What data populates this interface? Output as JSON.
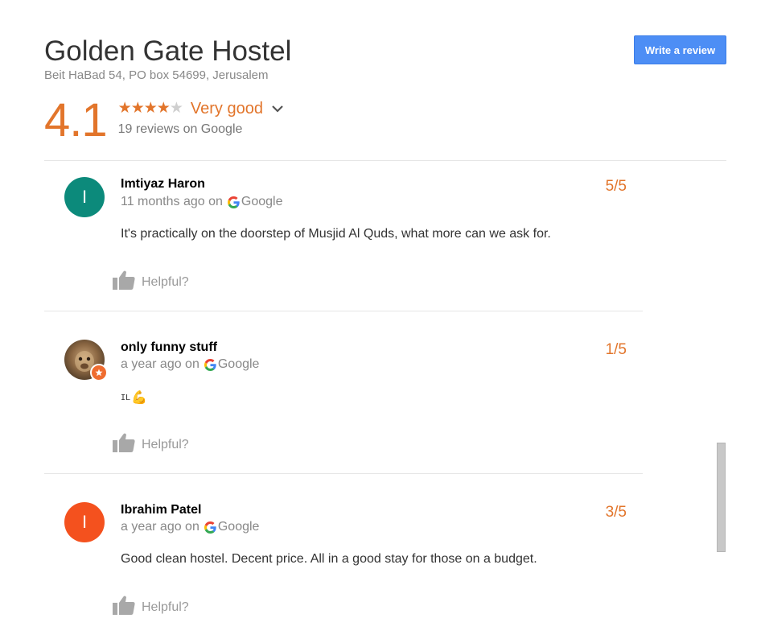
{
  "place": {
    "name": "Golden Gate Hostel",
    "address": "Beit HaBad 54, PO box 54699, Jerusalem"
  },
  "write_review_label": "Write a review",
  "summary": {
    "rating": "4.1",
    "stars_filled": 4,
    "stars_total": 5,
    "rating_word": "Very good",
    "review_count_text": "19 reviews on Google"
  },
  "colors": {
    "accent_orange": "#e2752b",
    "button_blue": "#4d8ef5",
    "avatar_teal": "#0c8a7b",
    "avatar_orange": "#f4511e"
  },
  "reviews": [
    {
      "author": "Imtiyaz Haron",
      "avatar_initial": "I",
      "avatar_type": "initial",
      "time": "11 months ago on",
      "source": "Google",
      "score": "5/5",
      "text": "It's practically on the doorstep of Musjid Al Quds, what more can we ask for.",
      "helpful_label": "Helpful?"
    },
    {
      "author": "only funny stuff",
      "avatar_type": "photo",
      "time": "a year ago on",
      "source": "Google",
      "score": "1/5",
      "text": "IL",
      "emoji": "💪",
      "helpful_label": "Helpful?"
    },
    {
      "author": "Ibrahim Patel",
      "avatar_initial": "I",
      "avatar_type": "initial",
      "time": "a year ago on",
      "source": "Google",
      "score": "3/5",
      "text": "Good clean hostel. Decent price. All in a good stay for those on a budget.",
      "helpful_label": "Helpful?"
    }
  ]
}
